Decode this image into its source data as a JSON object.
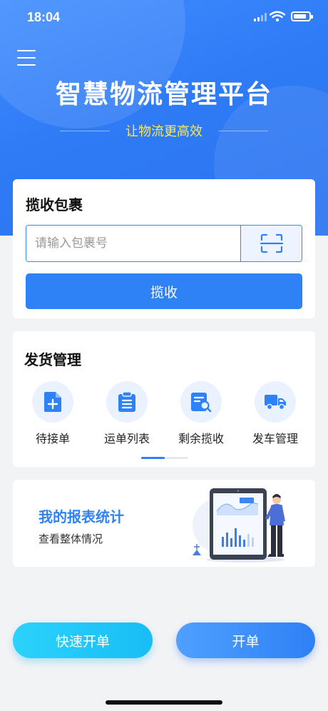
{
  "status_bar": {
    "time": "18:04"
  },
  "header": {
    "title": "智慧物流管理平台",
    "slogan": "让物流更高效"
  },
  "collect_card": {
    "title": "揽收包裹",
    "input_placeholder": "请输入包裹号",
    "button_label": "揽收"
  },
  "shipping_card": {
    "title": "发货管理",
    "items": [
      {
        "label": "待接单",
        "icon": "add-document-icon"
      },
      {
        "label": "运单列表",
        "icon": "clipboard-list-icon"
      },
      {
        "label": "剩余揽收",
        "icon": "document-search-icon"
      },
      {
        "label": "发车管理",
        "icon": "truck-icon"
      }
    ],
    "page_progress": 0.5
  },
  "report_card": {
    "title": "我的报表统计",
    "subtitle": "查看整体情况"
  },
  "actions": {
    "quick_order": "快速开单",
    "open_order": "开单"
  },
  "colors": {
    "primary": "#2e82f6",
    "slogan": "#ffe94d",
    "quick_button": "#18bdf6"
  }
}
